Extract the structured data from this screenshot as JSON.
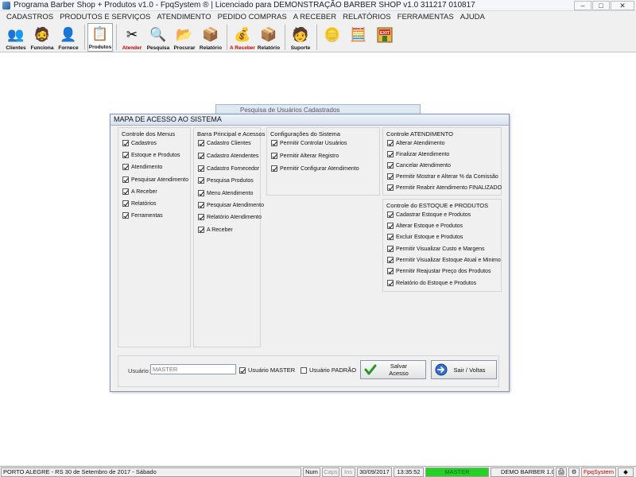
{
  "window": {
    "title": "Programa Barber Shop + Produtos v1.0 - FpqSystem ® | Licenciado para  DEMONSTRAÇÃO BARBER SHOP v1.0 311217 010817",
    "min": "–",
    "max": "□",
    "close": "✕"
  },
  "menu": [
    "CADASTROS",
    "PRODUTOS E SERVIÇOS",
    "ATENDIMENTO",
    "PEDIDO COMPRAS",
    "A RECEBER",
    "RELATÓRIOS",
    "FERRAMENTAS",
    "AJUDA"
  ],
  "toolbar": {
    "clientes": "Clientes",
    "funciona": "Funciona",
    "fornece": "Fornece",
    "produtos": "Produtos",
    "atender": "Atender",
    "pesquisa": "Pesquisa",
    "procurar": "Procurar",
    "relatorio": "Relatório",
    "areceber": "A Receber",
    "relatorio2": "Relatório",
    "suporte": "Suporte",
    "exit": "EXIT"
  },
  "bg_form_title": "Pesquisa de Usuários Cadastrados",
  "dialog": {
    "title": "MAPA DE ACESSO AO SISTEMA",
    "groups": {
      "menus": {
        "title": "Controle dos Menus",
        "items": [
          "Cadastros",
          "Estoque e Produtos",
          "Atendimento",
          "Pesquisar Atendimento",
          "A Receber",
          "Relatórios",
          "Ferramentas"
        ]
      },
      "barra": {
        "title": "Barra Principal e Acessos",
        "items": [
          "Cadastro Clientes",
          "Cadastro Atendentes",
          "Cadastro Fornecedor",
          "Pesquisa Produtos",
          "Menu Atendimento",
          "Pesquisar Atendimento",
          "Relatório Atendimento",
          "A Receber"
        ]
      },
      "config": {
        "title": "Configurações do Sistema",
        "items": [
          "Permitir Controlar Usuários",
          "Permitir Alterar Registro",
          "Permitir Configurar Atendimento"
        ]
      },
      "atendimento": {
        "title": "Controle ATENDIMENTO",
        "items": [
          "Alterar Atendimento",
          "Finalizar Atendimento",
          "Cancelar Atendimento",
          "Permitir Mostrar e Alterar % da Comissão",
          "Permitir Reabrir Atendimento FINALIZADO"
        ]
      },
      "estoque": {
        "title": "Controle do ESTOQUE e PRODUTOS",
        "items": [
          "Cadastrar Estoque e Produtos",
          "Alterar Estoque e Produtos",
          "Excluir Estoque e Produtos",
          "Permitir Visualizar Custo e Margens",
          "Permitir Visualizar Estoque Atual e Minimo",
          "Permitir Reajustar Preço dos Produtos",
          "Relatório do Estoque e Produtos"
        ]
      }
    },
    "user_label": "Usuário:",
    "user_value": "MASTER",
    "master_cb": "Usuário MASTER",
    "master_checked": true,
    "padrao_cb": "Usuário PADRÃO",
    "padrao_checked": false,
    "save_btn": "Salvar Acesso",
    "exit_btn": "Sair / Voltas"
  },
  "status": {
    "location": "PORTO ALEGRE - RS 30 de Setembro de 2017 - Sábado",
    "num": "Num",
    "caps": "Caps",
    "ins": "Ins",
    "date": "30/09/2017",
    "time": "13:35:52",
    "user": "MASTER",
    "version": "DEMO BARBER 1.0",
    "brand": "FpqSystem"
  },
  "colors": {
    "status_user_bg": "#22d322",
    "brand_red": "#c00000"
  }
}
